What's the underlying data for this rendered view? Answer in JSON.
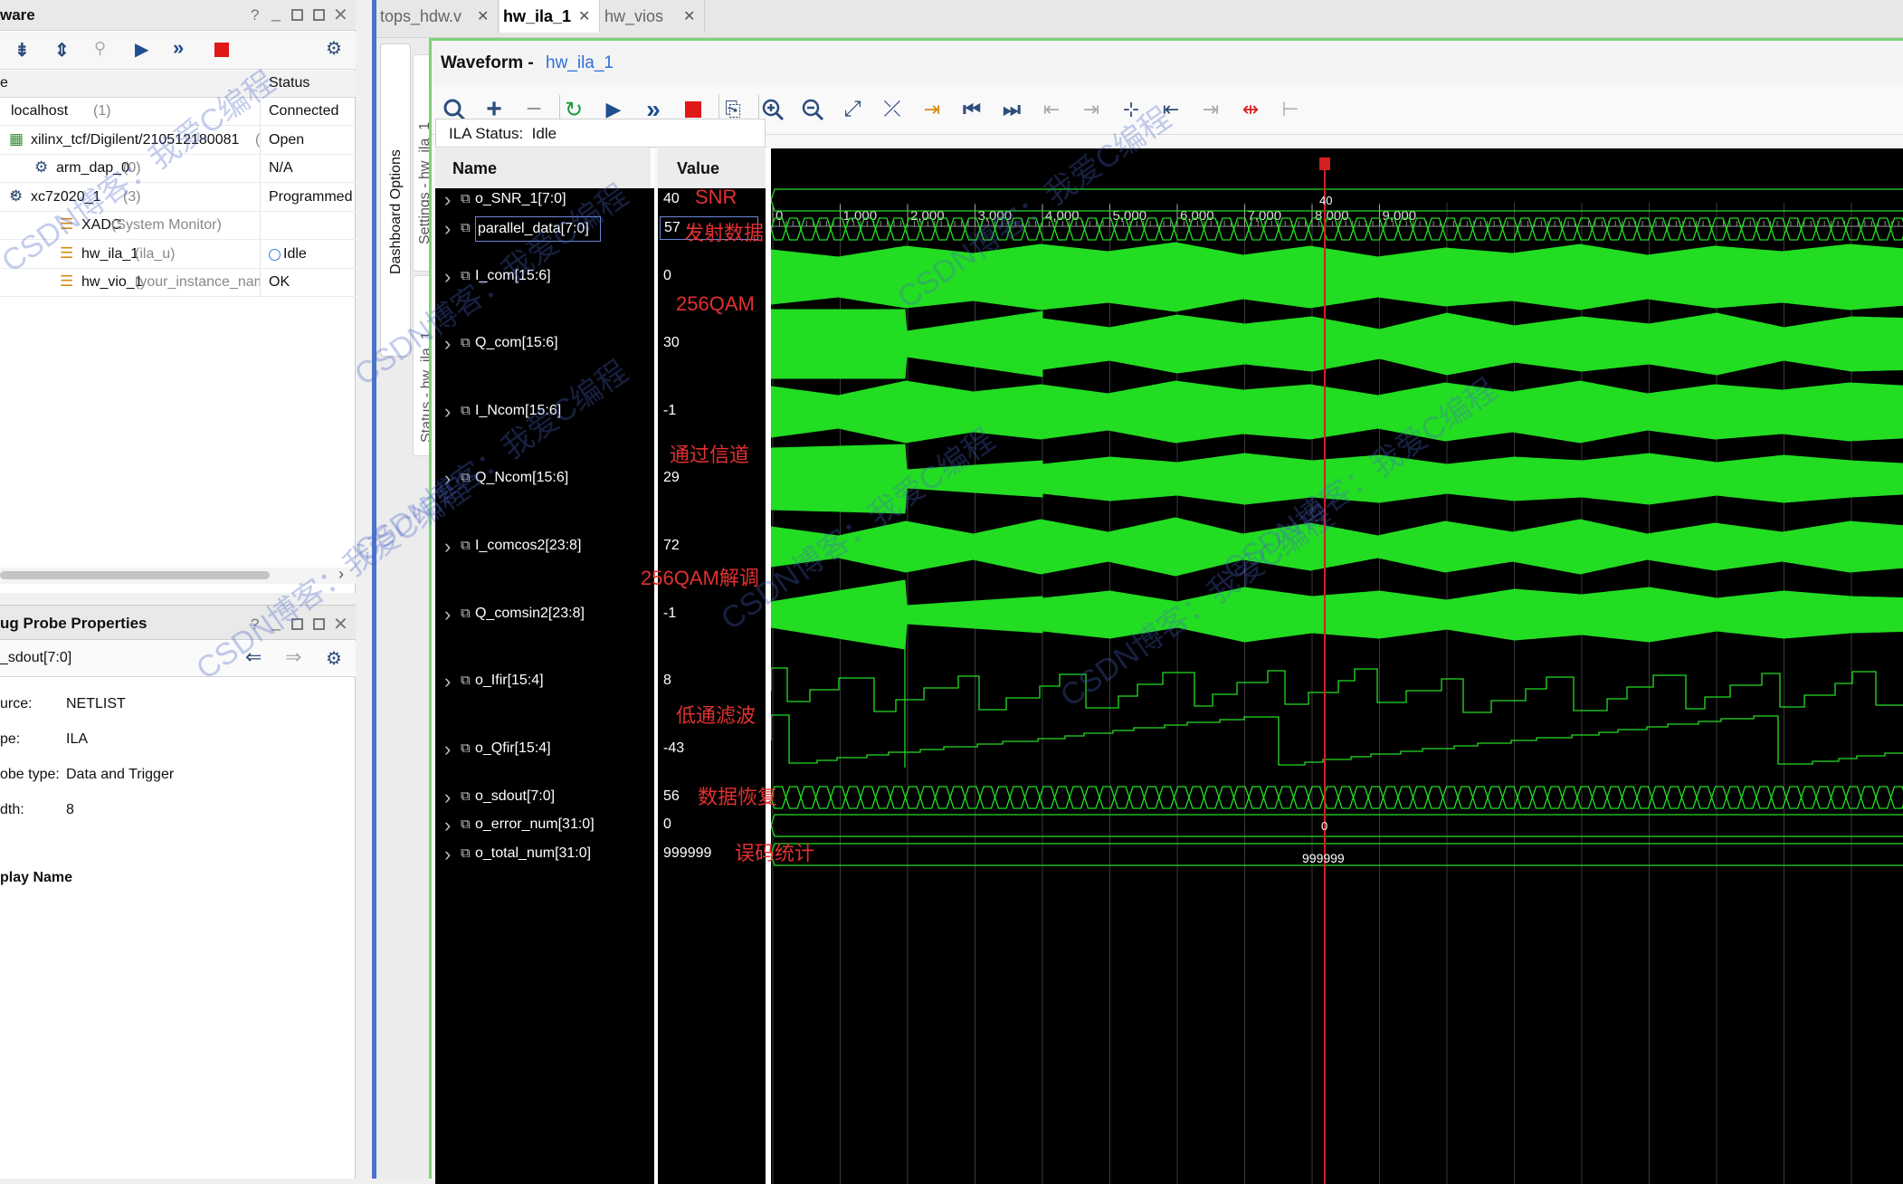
{
  "hw_panel": {
    "title": "ware",
    "col_name": "e",
    "col_status": "Status",
    "rows": [
      {
        "name": "localhost",
        "extra": "(1)",
        "status": "Connected"
      },
      {
        "name": "xilinx_tcf/Digilent/210512180081",
        "extra": "(",
        "status": "Open"
      },
      {
        "name": "arm_dap_0",
        "extra": "(0)",
        "status": "N/A"
      },
      {
        "name": "xc7z020_1",
        "extra": "(3)",
        "status": "Programmed"
      },
      {
        "name": "XADC",
        "extra": "(System Monitor)",
        "status": ""
      },
      {
        "name": "hw_ila_1",
        "extra": "(ila_u)",
        "status": "Idle"
      },
      {
        "name": "hw_vio_1",
        "extra": "(your_instance_nam",
        "status": "OK"
      }
    ]
  },
  "probe_panel": {
    "title": "ug Probe Properties",
    "probe": "_sdout[7:0]",
    "props": [
      {
        "label": "urce:",
        "value": "NETLIST"
      },
      {
        "label": "pe:",
        "value": "ILA"
      },
      {
        "label": "obe type:",
        "value": "Data and Trigger"
      },
      {
        "label": "dth:",
        "value": "8"
      }
    ],
    "display_name": "play Name"
  },
  "tabs": [
    {
      "label": "tops_hdw.v",
      "active": false
    },
    {
      "label": "hw_ila_1",
      "active": true
    },
    {
      "label": "hw_vios",
      "active": false
    }
  ],
  "vtabs": {
    "dashboard": "Dashboard Options",
    "settings": "Settings - hw_ila_1",
    "status": "Status - hw_ila_1"
  },
  "waveform": {
    "title_prefix": "Waveform - ",
    "title_link": "hw_ila_1",
    "ila_status": "ILA Status:  Idle",
    "col_name": "Name",
    "col_value": "Value",
    "ruler": [
      "0",
      "1,000",
      "2,000",
      "3,000",
      "4,000",
      "5,000",
      "6,000",
      "7,000",
      "8,000",
      "9,000"
    ],
    "cursor_label_top": "40",
    "cursor_label_err": "0",
    "cursor_label_total": "999999",
    "signals": [
      {
        "name": "o_SNR_1[7:0]",
        "value": "40"
      },
      {
        "name": "parallel_data[7:0]",
        "value": "57"
      },
      {
        "name": "I_com[15:6]",
        "value": "0"
      },
      {
        "name": "Q_com[15:6]",
        "value": "30"
      },
      {
        "name": "I_Ncom[15:6]",
        "value": "-1"
      },
      {
        "name": "Q_Ncom[15:6]",
        "value": "29"
      },
      {
        "name": "I_comcos2[23:8]",
        "value": "72"
      },
      {
        "name": "Q_comsin2[23:8]",
        "value": "-1"
      },
      {
        "name": "o_Ifir[15:4]",
        "value": "8"
      },
      {
        "name": "o_Qfir[15:4]",
        "value": "-43"
      },
      {
        "name": "o_sdout[7:0]",
        "value": "56"
      },
      {
        "name": "o_error_num[31:0]",
        "value": "0"
      },
      {
        "name": "o_total_num[31:0]",
        "value": "999999"
      }
    ],
    "annotations": [
      "SNR",
      "发射数据",
      "256QAM",
      "通过信道",
      "256QAM解调",
      "低通滤波",
      "数据恢复",
      "误码统计"
    ]
  },
  "watermarks": [
    "CSDN博客：我爱C编程"
  ],
  "colors": {
    "wave": "#22dd22",
    "cursor": "#d42020",
    "annotation": "#e23030",
    "accent": "#2f6fd6",
    "selected_tab_border": "#3c8ef0",
    "panel_green": "#7ad47a"
  }
}
